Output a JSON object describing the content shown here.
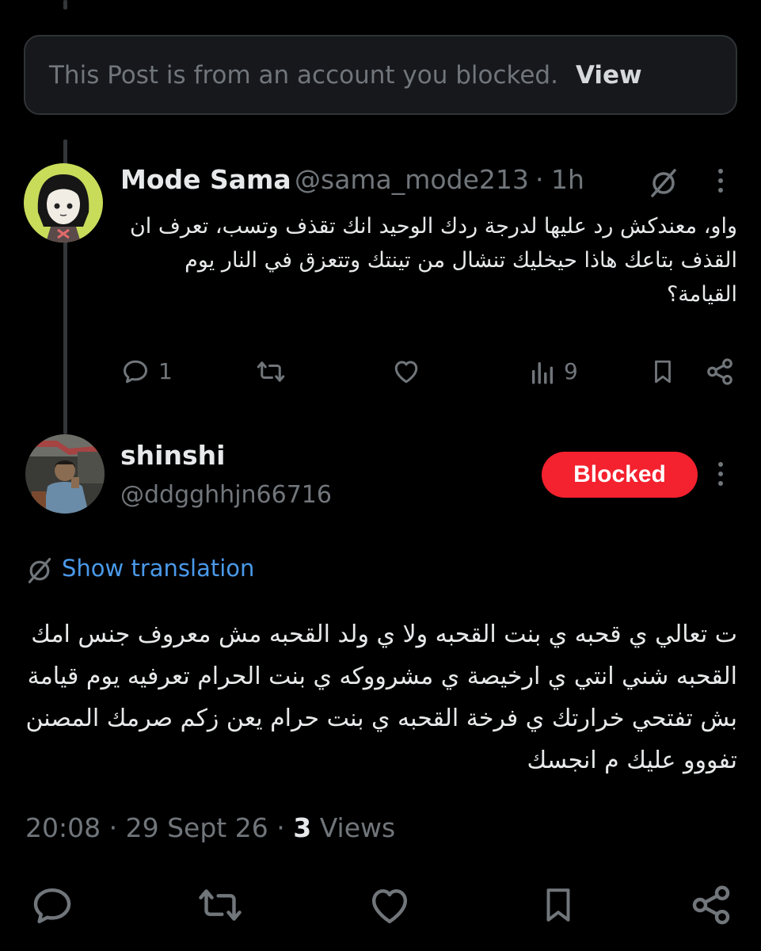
{
  "blocked_notice": {
    "text": "This Post is from an account you blocked.",
    "view_label": "View"
  },
  "reply_post": {
    "author_name": "Mode Sama",
    "handle": "@sama_mode213",
    "separator": "·",
    "time": "1h",
    "avatar_icon": "anime-girl-avatar",
    "text": "واو، معندكش رد عليها لدرجة ردك الوحيد انك تقذف وتسب، تعرف ان القذف بتاعك هاذا حيخليك تنشال من تينتك وتتعزق في النار يوم القيامة؟",
    "actions": {
      "reply_count": "1",
      "repost_count": "",
      "like_count": "",
      "views_count": "9"
    }
  },
  "main_post": {
    "author_name": "shinshi",
    "handle": "@ddgghhjn66716",
    "avatar_icon": "man-photo-avatar",
    "blocked_label": "Blocked",
    "show_translation_label": "Show translation",
    "text": "ت تعالي ي قحبه ي بنت القحبه ولا ي ولد القحبه مش معروف جنس امك القحبه شني انتي ي ارخيصة ي مشرووكه ي بنت الحرام تعرفيه يوم قيامة بش تفتحي خرارتك ي فرخة القحبه ي بنت حرام يعن زكم صرمك المصنن تفووو عليك م انجسك",
    "time": "20:08",
    "date": "29 Sept 26",
    "dot": "·",
    "views_count": "3",
    "views_label": "Views"
  },
  "colors": {
    "background": "#000000",
    "text_primary": "#e7e9ea",
    "text_secondary": "#71767b",
    "link": "#4a99e9",
    "blocked_red": "#f4212e",
    "notice_bg": "#16181c",
    "border": "#2f3336"
  }
}
